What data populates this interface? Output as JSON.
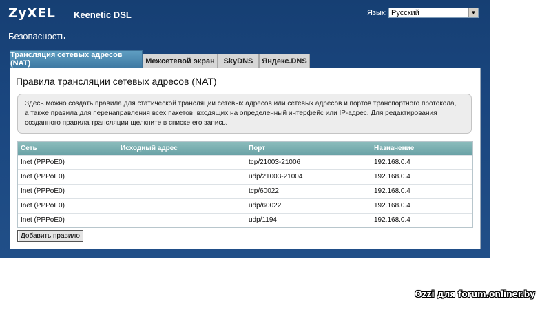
{
  "header": {
    "logo": "ZyXEL",
    "product": "Keenetic DSL",
    "language_label": "Язык:",
    "language_value": "Русский"
  },
  "page": {
    "section_title": "Безопасность"
  },
  "tabs": [
    {
      "label": "Трансляция сетевых адресов (NAT)",
      "active": true
    },
    {
      "label": "Межсетевой экран",
      "active": false
    },
    {
      "label": "SkyDNS",
      "active": false
    },
    {
      "label": "Яндекс.DNS",
      "active": false
    }
  ],
  "panel": {
    "title": "Правила трансляции сетевых адресов (NAT)",
    "info_lines": [
      "Здесь можно создать правила для статической трансляции сетевых адресов или сетевых адресов и портов транспортного протокола,",
      "а также правила для перенаправления всех пакетов, входящих на определенный интерфейс или IP-адрес. Для редактирования",
      "созданного правила трансляции щелкните в списке его запись."
    ]
  },
  "table": {
    "headers": [
      "Сеть",
      "Исходный адрес",
      "Порт",
      "Назначение"
    ],
    "rows": [
      [
        "Inet (PPPoE0)",
        "",
        "tcp/21003-21006",
        "192.168.0.4"
      ],
      [
        "Inet (PPPoE0)",
        "",
        "udp/21003-21004",
        "192.168.0.4"
      ],
      [
        "Inet (PPPoE0)",
        "",
        "tcp/60022",
        "192.168.0.4"
      ],
      [
        "Inet (PPPoE0)",
        "",
        "udp/60022",
        "192.168.0.4"
      ],
      [
        "Inet (PPPoE0)",
        "",
        "udp/1194",
        "192.168.0.4"
      ]
    ]
  },
  "buttons": {
    "add_rule": "Добавить правило"
  },
  "watermark": "Ozzi для forum.onliner.by",
  "icons": {
    "dropdown": "chevron-down-icon"
  },
  "colors": {
    "background": "#1a467f",
    "active_tab": "#4a88b0",
    "table_header": "#7ab0b2"
  }
}
